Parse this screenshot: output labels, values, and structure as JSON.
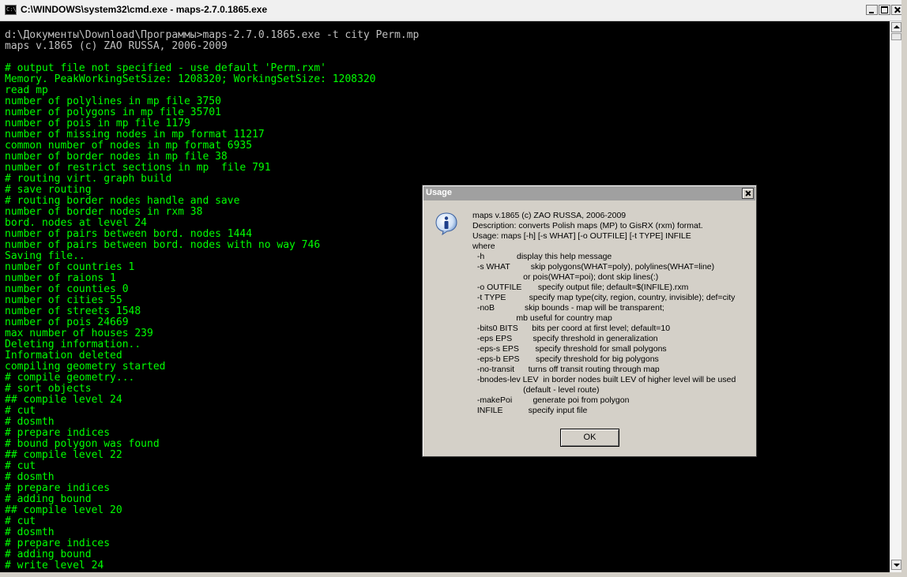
{
  "window": {
    "title": "C:\\WINDOWS\\system32\\cmd.exe - maps-2.7.0.1865.exe",
    "app_icon_text": "C:\\"
  },
  "console": {
    "lines": [
      {
        "text": "d:\\Документы\\Download\\Программы>maps-2.7.0.1865.exe -t city Perm.mp",
        "color": "#c0c0c0"
      },
      {
        "text": "maps v.1865 (c) ZAO RUSSA, 2006-2009",
        "color": "#c0c0c0"
      },
      {
        "text": "",
        "color": "#c0c0c0"
      },
      {
        "text": "# output file not specified - use default 'Perm.rxm'",
        "color": "#00ff00"
      },
      {
        "text": "Memory. PeakWorkingSetSize: 1208320; WorkingSetSize: 1208320",
        "color": "#00ff00"
      },
      {
        "text": "read mp",
        "color": "#00ff00"
      },
      {
        "text": "number of polylines in mp file 3750",
        "color": "#00ff00"
      },
      {
        "text": "number of polygons in mp file 35701",
        "color": "#00ff00"
      },
      {
        "text": "number of pois in mp file 1179",
        "color": "#00ff00"
      },
      {
        "text": "number of missing nodes in mp format 11217",
        "color": "#00ff00"
      },
      {
        "text": "common number of nodes in mp format 6935",
        "color": "#00ff00"
      },
      {
        "text": "number of border nodes in mp file 38",
        "color": "#00ff00"
      },
      {
        "text": "number of restrict sections in mp  file 791",
        "color": "#00ff00"
      },
      {
        "text": "# routing virt. graph build",
        "color": "#00ff00"
      },
      {
        "text": "# save routing",
        "color": "#00ff00"
      },
      {
        "text": "# routing border nodes handle and save",
        "color": "#00ff00"
      },
      {
        "text": "number of border nodes in rxm 38",
        "color": "#00ff00"
      },
      {
        "text": "bord. nodes at level 24",
        "color": "#00ff00"
      },
      {
        "text": "number of pairs between bord. nodes 1444",
        "color": "#00ff00"
      },
      {
        "text": "number of pairs between bord. nodes with no way 746",
        "color": "#00ff00"
      },
      {
        "text": "Saving file..",
        "color": "#00ff00"
      },
      {
        "text": "number of countries 1",
        "color": "#00ff00"
      },
      {
        "text": "number of raions 1",
        "color": "#00ff00"
      },
      {
        "text": "number of counties 0",
        "color": "#00ff00"
      },
      {
        "text": "number of cities 55",
        "color": "#00ff00"
      },
      {
        "text": "number of streets 1548",
        "color": "#00ff00"
      },
      {
        "text": "number of pois 24669",
        "color": "#00ff00"
      },
      {
        "text": "max number of houses 239",
        "color": "#00ff00"
      },
      {
        "text": "Deleting information..",
        "color": "#00ff00"
      },
      {
        "text": "Information deleted",
        "color": "#00ff00"
      },
      {
        "text": "compiling geometry started",
        "color": "#00ff00"
      },
      {
        "text": "# compile geometry...",
        "color": "#00ff00"
      },
      {
        "text": "# sort objects",
        "color": "#00ff00"
      },
      {
        "text": "## compile level 24",
        "color": "#00ff00"
      },
      {
        "text": "# cut",
        "color": "#00ff00"
      },
      {
        "text": "# dosmth",
        "color": "#00ff00"
      },
      {
        "text": "# prepare indices",
        "color": "#00ff00"
      },
      {
        "text": "# bound polygon was found",
        "color": "#00ff00"
      },
      {
        "text": "## compile level 22",
        "color": "#00ff00"
      },
      {
        "text": "# cut",
        "color": "#00ff00"
      },
      {
        "text": "# dosmth",
        "color": "#00ff00"
      },
      {
        "text": "# prepare indices",
        "color": "#00ff00"
      },
      {
        "text": "# adding bound",
        "color": "#00ff00"
      },
      {
        "text": "## compile level 20",
        "color": "#00ff00"
      },
      {
        "text": "# cut",
        "color": "#00ff00"
      },
      {
        "text": "# dosmth",
        "color": "#00ff00"
      },
      {
        "text": "# prepare indices",
        "color": "#00ff00"
      },
      {
        "text": "# adding bound",
        "color": "#00ff00"
      },
      {
        "text": "# write level 24",
        "color": "#00ff00"
      }
    ]
  },
  "dialog": {
    "title": "Usage",
    "icon": "information-icon",
    "lines": [
      "maps v.1865 (c) ZAO RUSSA, 2006-2009",
      "Description: converts Polish maps (MP) to GisRX (rxm) format.",
      "Usage: maps [-h] [-s WHAT] [-o OUTFILE] [-t TYPE] INFILE",
      "where",
      "  -h              display this help message",
      "  -s WHAT         skip polygons(WHAT=poly), polylines(WHAT=line)",
      "                      or pois(WHAT=poi); dont skip lines(:)",
      "  -o OUTFILE       specify output file; default=$(INFILE).rxm",
      "  -t TYPE          specify map type(city, region, country, invisible); def=city",
      "  -noB             skip bounds - map will be transparent;",
      "                   mb useful for country map",
      "  -bits0 BITS      bits per coord at first level; default=10",
      "  -eps EPS         specify threshold in generalization",
      "  -eps-s EPS       specify threshold for small polygons",
      "  -eps-b EPS       specify threshold for big polygons",
      "  -no-transit      turns off transit routing through map",
      "  -bnodes-lev LEV  in border nodes built LEV of higher level will be used",
      "                      (default - level route)",
      "  -makePoi         generate poi from polygon",
      "  INFILE           specify input file"
    ],
    "ok_label": "OK"
  }
}
